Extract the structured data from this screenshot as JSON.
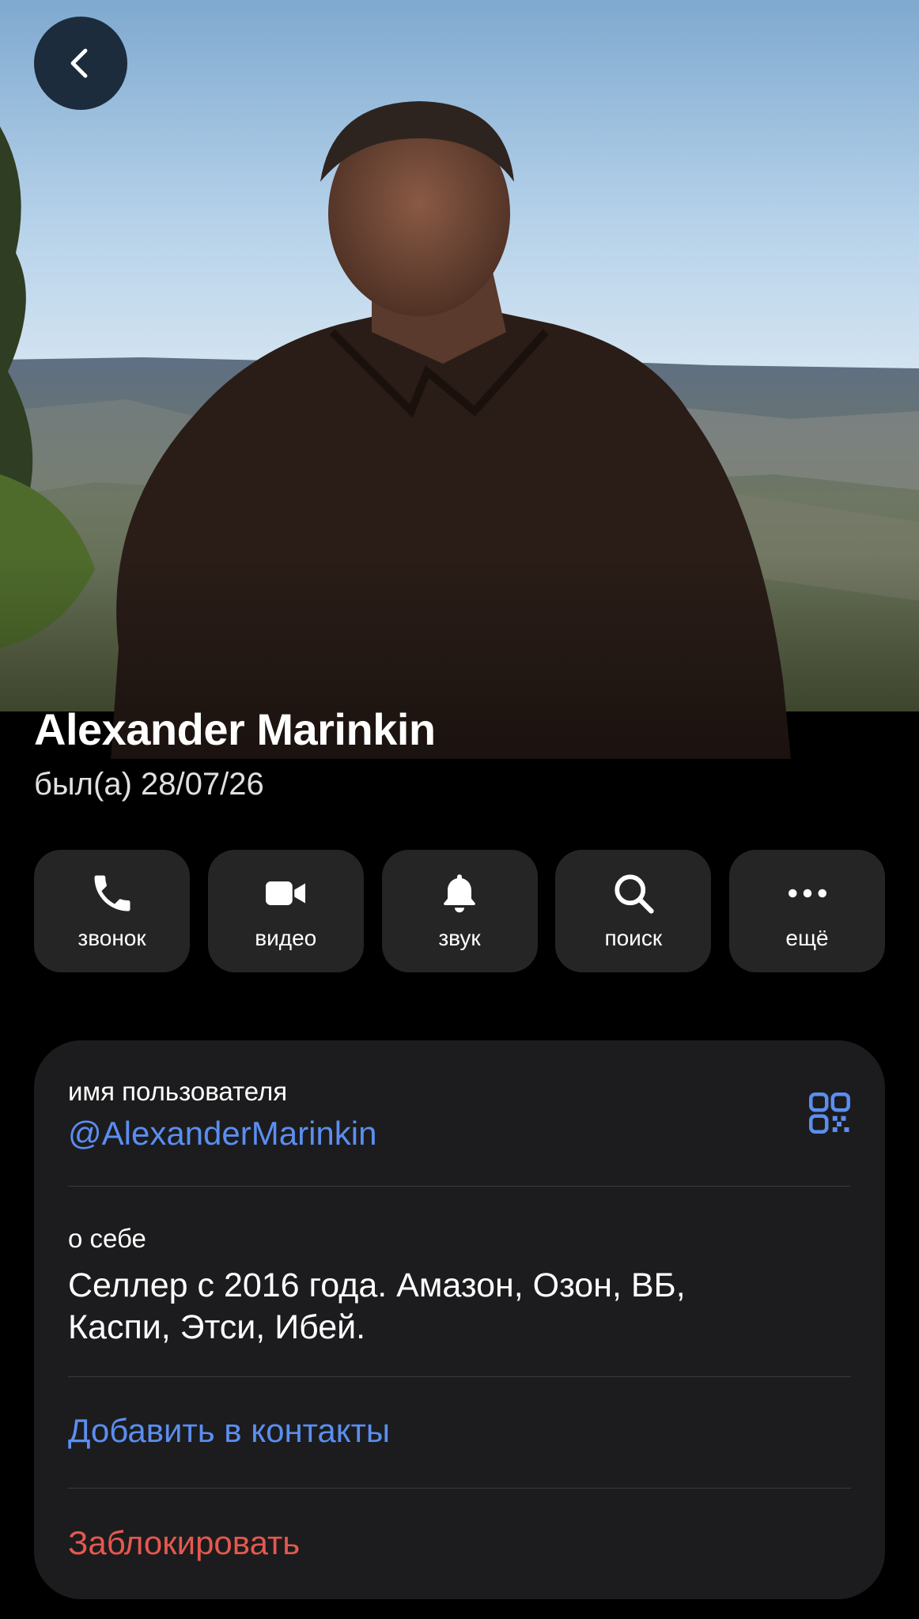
{
  "header": {
    "name": "Alexander Marinkin",
    "status": "был(а) 28/07/26"
  },
  "actions": [
    {
      "label": "звонок",
      "icon": "phone-icon"
    },
    {
      "label": "видео",
      "icon": "video-camera-icon"
    },
    {
      "label": "звук",
      "icon": "bell-icon"
    },
    {
      "label": "поиск",
      "icon": "search-icon"
    },
    {
      "label": "ещё",
      "icon": "more-dots-icon"
    }
  ],
  "info": {
    "username_label": "имя пользователя",
    "username": "@AlexanderMarinkin",
    "bio_label": "о себе",
    "bio": "Селлер с 2016 года. Амазон, Озон, ВБ, Каспи, Этси, Ибей.",
    "add_contact": "Добавить в контакты",
    "block": "Заблокировать"
  },
  "colors": {
    "accent_link": "#5b8ef0",
    "destructive": "#e5584f",
    "card_background": "#1c1c1e",
    "button_background": "#3c3c3c",
    "back_button": "#1c2c3c"
  }
}
